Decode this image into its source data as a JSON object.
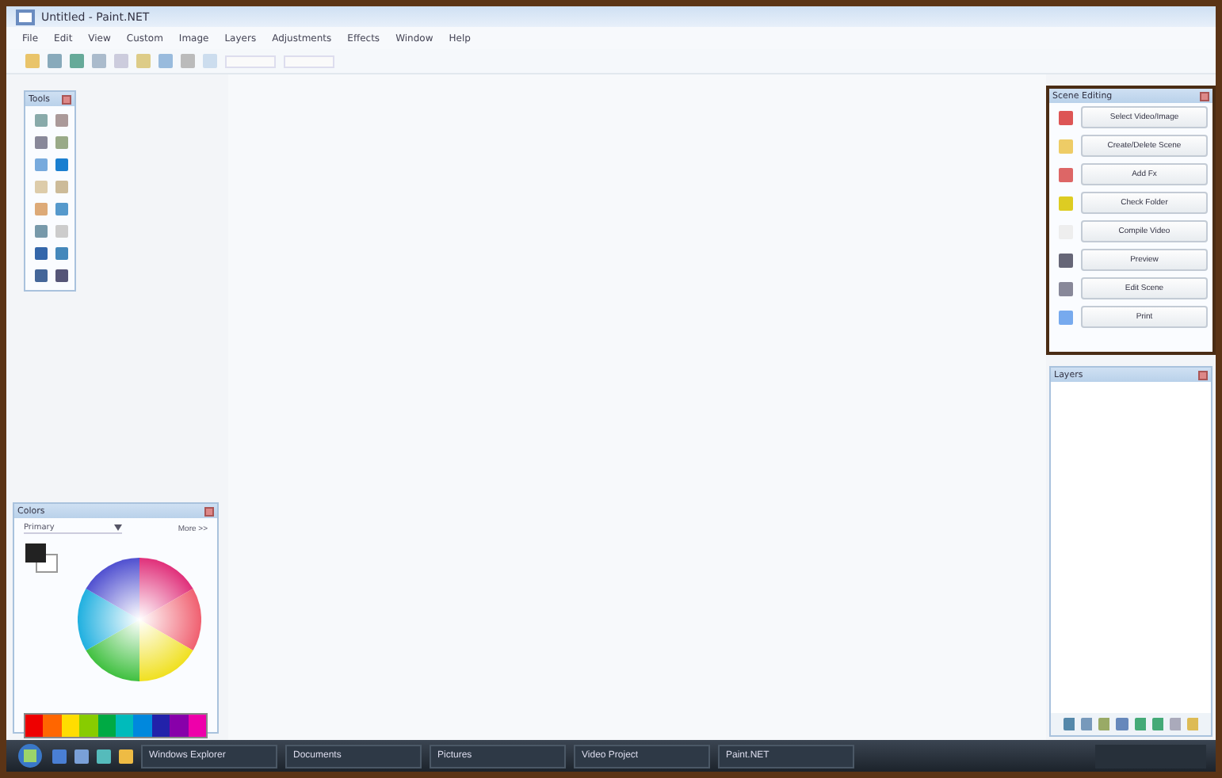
{
  "window": {
    "title": "Untitled - Paint.NET"
  },
  "menu": [
    "File",
    "Edit",
    "View",
    "Custom",
    "Image",
    "Layers",
    "Adjustments",
    "Effects",
    "Window",
    "Help"
  ],
  "tools_panel": {
    "title": "Tools"
  },
  "colors_panel": {
    "title": "Colors",
    "mode": "Primary",
    "more_button": "More >>"
  },
  "scene_panel": {
    "title": "Scene Editing",
    "buttons": [
      "Select Video/Image",
      "Create/Delete Scene",
      "Add Fx",
      "Check Folder",
      "Compile Video",
      "Preview",
      "Edit Scene",
      "Print"
    ]
  },
  "layers_panel": {
    "title": "Layers"
  },
  "taskbar": {
    "items": [
      "Windows Explorer",
      "Documents",
      "Pictures",
      "Video Project",
      "Paint.NET"
    ]
  }
}
